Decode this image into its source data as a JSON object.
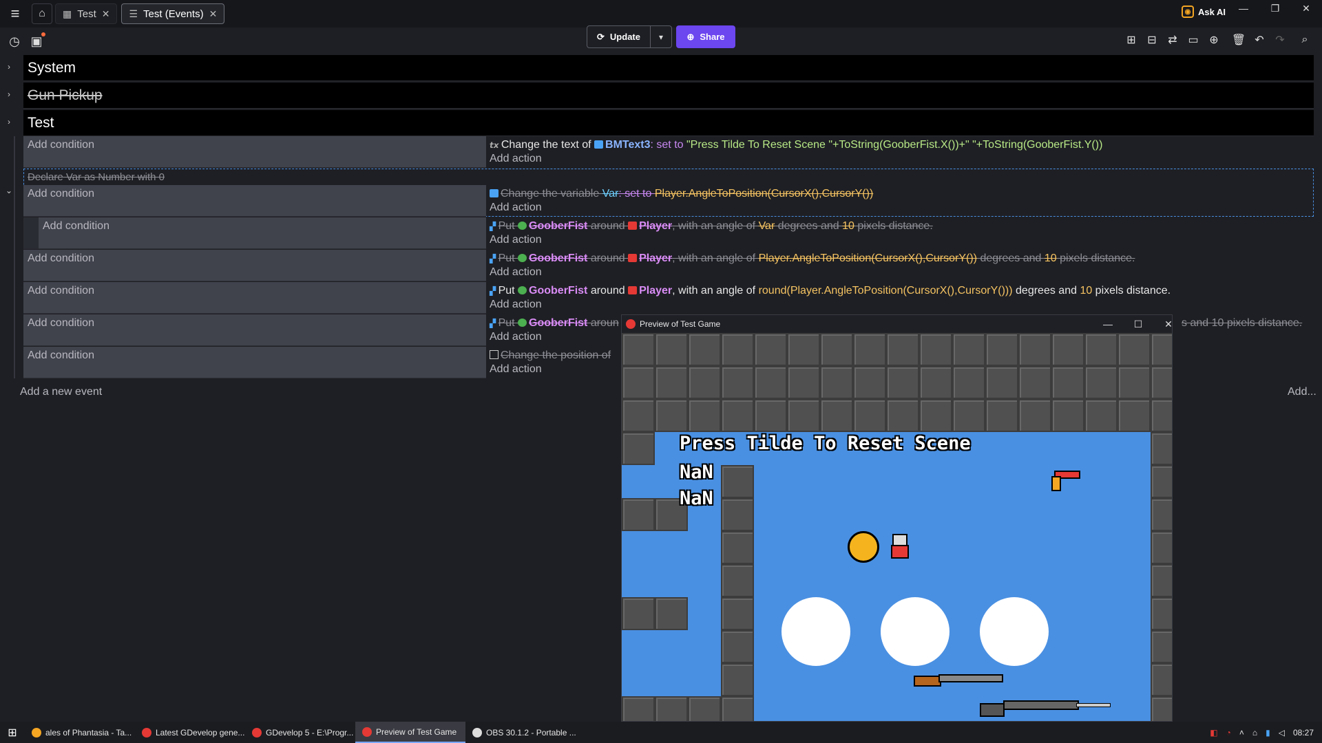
{
  "tabs": [
    {
      "label": "Test",
      "icon": "film-icon"
    },
    {
      "label": "Test (Events)",
      "icon": "events-icon"
    }
  ],
  "header": {
    "ask_ai": "Ask AI"
  },
  "toolbar": {
    "update_label": "Update",
    "share_label": "Share"
  },
  "groups": [
    "System",
    "Gun Pickup",
    "Test"
  ],
  "events": {
    "add_condition": "Add condition",
    "add_action": "Add action",
    "e1": {
      "pre": "Change the text of ",
      "obj": "BMText3",
      "mid": ": set to ",
      "value": "\"Press Tilde To Reset Scene \"+ToString(GooberFist.X())+\" \"+ToString(GooberFist.Y())"
    },
    "declare": "Declare  Var as  Number with 0",
    "e2": {
      "pre": "Change the variable ",
      "var": "Var",
      "mid": ": set to ",
      "value": "Player.AngleToPosition(CursorX(),CursorY())"
    },
    "e3": {
      "put": "Put ",
      "obj1": "GooberFist",
      "around": " around ",
      "obj2": "Player",
      "angle": ", with an angle of ",
      "value": "Var",
      "deg": " degrees and ",
      "dist": "10",
      "px": " pixels distance."
    },
    "e4": {
      "put": "Put ",
      "obj1": "GooberFist",
      "around": " around ",
      "obj2": "Player",
      "angle": ", with an angle of ",
      "value": "Player.AngleToPosition(CursorX(),CursorY())",
      "deg": " degrees and ",
      "dist": "10",
      "px": " pixels distance."
    },
    "e5": {
      "put": "Put ",
      "obj1": "GooberFist",
      "around": " around ",
      "obj2": "Player",
      "angle": ", with an angle of ",
      "value": "round(Player.AngleToPosition(CursorX(),CursorY()))",
      "deg": " degrees and ",
      "dist": "10",
      "px": " pixels distance."
    },
    "e6": {
      "put": "Put ",
      "obj1": "GooberFist",
      "around": " aroun",
      "tail": "s and 10 pixels distance."
    },
    "e7": {
      "pre": "Change the position of "
    },
    "add_event": "Add a new event",
    "add_right": "Add..."
  },
  "preview": {
    "title": "Preview of Test Game",
    "game_text": "Press Tilde To Reset Scene",
    "nan1": "NaN",
    "nan2": "NaN"
  },
  "taskbar": {
    "items": [
      {
        "label": "ales of Phantasia - Ta...",
        "color": "#f5a623"
      },
      {
        "label": "Latest GDevelop gene...",
        "color": "#e53935"
      },
      {
        "label": "GDevelop 5 - E:\\Progr...",
        "color": "#e53935"
      },
      {
        "label": "Preview of Test Game",
        "color": "#e53935"
      },
      {
        "label": "OBS 30.1.2 - Portable ...",
        "color": "#dddddd"
      }
    ],
    "time": "08:27"
  },
  "colors": {
    "accent": "#6c46ef",
    "game_bg": "#4a90e2"
  }
}
